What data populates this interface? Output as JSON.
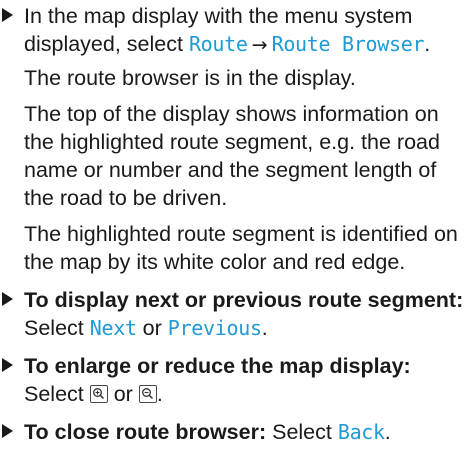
{
  "steps": [
    {
      "lead": "In the map display with the menu system displayed, select ",
      "menu_1": "Route",
      "arrow": "→",
      "menu_2": "Route Browser",
      "tail": ".",
      "results": [
        "The route browser is in the display.",
        "The top of the display shows information on the highlighted route segment, e.g. the road name or number and the segment length of the road to be driven.",
        "The highlighted route segment is identified on the map by its white color and red edge."
      ]
    },
    {
      "bold": "To display next or previous route segment:",
      "pre": " Select ",
      "opt_1": "Next",
      "or": " or ",
      "opt_2": "Previous",
      "tail": "."
    },
    {
      "bold": "To enlarge or reduce the map display:",
      "pre": " Select ",
      "icon_1": "zoom-in-icon",
      "or": " or ",
      "icon_2": "zoom-out-icon",
      "tail": "."
    },
    {
      "bold": "To close route browser:",
      "pre": " Select ",
      "opt_1": "Back",
      "tail": "."
    }
  ],
  "colors": {
    "ui_text": "#1e9ad6",
    "body_text": "#1a1a1a"
  }
}
